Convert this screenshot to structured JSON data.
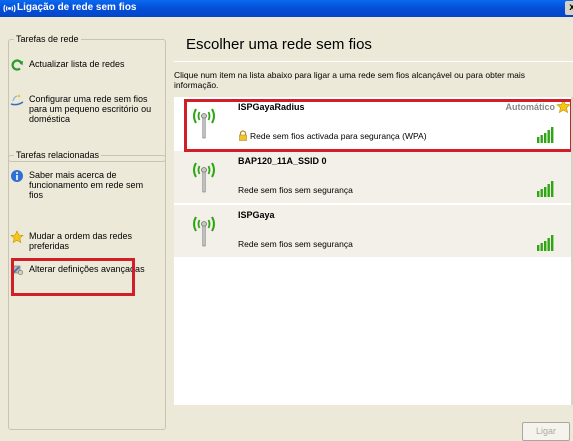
{
  "window": {
    "title": "Ligação de rede sem fios",
    "close_glyph": "x"
  },
  "tasks_network": {
    "title": "Tarefas de rede",
    "items": [
      {
        "label": "Actualizar lista de redes",
        "icon": "refresh-icon"
      },
      {
        "label": "Configurar uma rede sem fios para um pequeno escritório ou doméstica",
        "icon": "wizard-icon"
      }
    ]
  },
  "tasks_related": {
    "title": "Tarefas relacionadas",
    "items": [
      {
        "label": "Saber mais acerca de funcionamento em rede sem fios",
        "icon": "info-icon"
      },
      {
        "label": "Mudar a ordem das redes preferidas",
        "icon": "star-icon"
      },
      {
        "label": "Alterar definições avançadas",
        "icon": "settings-icon"
      }
    ]
  },
  "main": {
    "heading": "Escolher uma rede sem fios",
    "instruction": "Clique num item na lista abaixo para ligar a uma rede sem fios alcançável ou para obter mais informação.",
    "connect_label": "Ligar"
  },
  "networks": [
    {
      "name": "ISPGayaRadius",
      "status": "Rede sem fios activada para segurança (WPA)",
      "mode": "Automático",
      "secured": true,
      "preferred": true,
      "signal_bars": 5,
      "signal_max": 5
    },
    {
      "name": "BAP120_11A_SSID 0",
      "status": "Rede sem fios sem segurança",
      "secured": false,
      "signal_bars": 5,
      "signal_max": 5
    },
    {
      "name": "ISPGaya",
      "status": "Rede sem fios sem segurança",
      "secured": false,
      "signal_bars": 5,
      "signal_max": 5
    }
  ],
  "colors": {
    "titlebar": "#0550d8",
    "highlight_box": "#d21e28",
    "signal_green": "#2ea614",
    "panel_bg": "#ece9d8"
  }
}
